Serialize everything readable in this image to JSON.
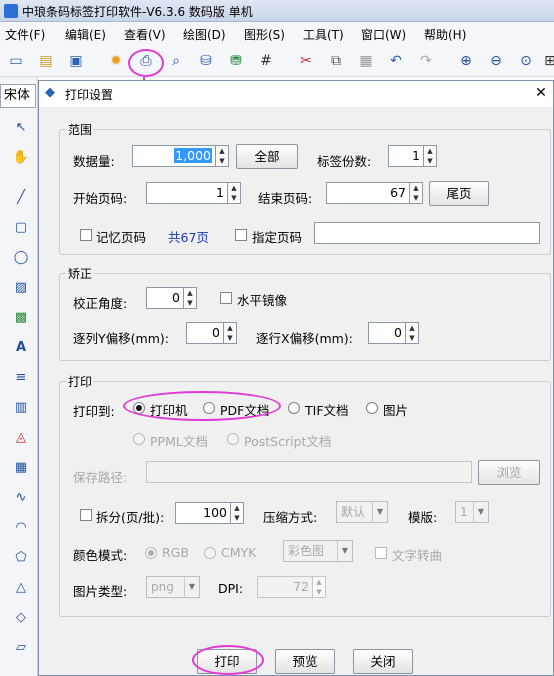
{
  "app": {
    "title": "中琅条码标签打印软件-V6.3.6 数码版 单机",
    "menus": [
      "文件(F)",
      "编辑(E)",
      "查看(V)",
      "绘图(D)",
      "图形(S)",
      "工具(T)",
      "窗口(W)",
      "帮助(H)"
    ],
    "font_box": "宋体"
  },
  "dialog": {
    "title": "打印设置",
    "range": {
      "group_title": "范围",
      "data_count_label": "数据量:",
      "data_count_value": "1,000",
      "all_button": "全部",
      "label_copies_label": "标签份数:",
      "label_copies_value": "1",
      "start_page_label": "开始页码:",
      "start_page_value": "1",
      "end_page_label": "结束页码:",
      "end_page_value": "67",
      "last_page_button": "尾页",
      "remember_page_label": "记忆页码",
      "total_pages_text": "共67页",
      "specify_page_label": "指定页码",
      "specify_page_value": ""
    },
    "correction": {
      "group_title": "矫正",
      "angle_label": "校正角度:",
      "angle_value": "0",
      "mirror_label": "水平镜像",
      "y_offset_label": "逐列Y偏移(mm):",
      "y_offset_value": "0",
      "x_offset_label": "逐行X偏移(mm):",
      "x_offset_value": "0"
    },
    "print": {
      "group_title": "打印",
      "print_to_label": "打印到:",
      "options": [
        "打印机",
        "PDF文档",
        "TIF文档",
        "图片"
      ],
      "selected": "打印机",
      "options2": [
        "PPML文档",
        "PostScript文档"
      ],
      "save_path_label": "保存路径:",
      "save_path_value": "",
      "browse_button": "浏览",
      "split_label": "拆分(页/批):",
      "split_value": "100",
      "compress_label": "压缩方式:",
      "compress_value": "默认",
      "template_label": "模版:",
      "template_value": "1",
      "color_mode_label": "颜色模式:",
      "color_modes": [
        "RGB",
        "CMYK"
      ],
      "color_selected": "RGB",
      "color_combo_value": "彩色图",
      "text_convert_label": "文字转曲",
      "image_type_label": "图片类型:",
      "image_type_value": "png",
      "dpi_label": "DPI:",
      "dpi_value": "72"
    },
    "buttons": {
      "print": "打印",
      "preview": "预览",
      "close": "关闭"
    }
  },
  "colors": {
    "highlight": "#e23ad6",
    "link_blue": "#1a35c9",
    "selection": "#3399ff"
  }
}
